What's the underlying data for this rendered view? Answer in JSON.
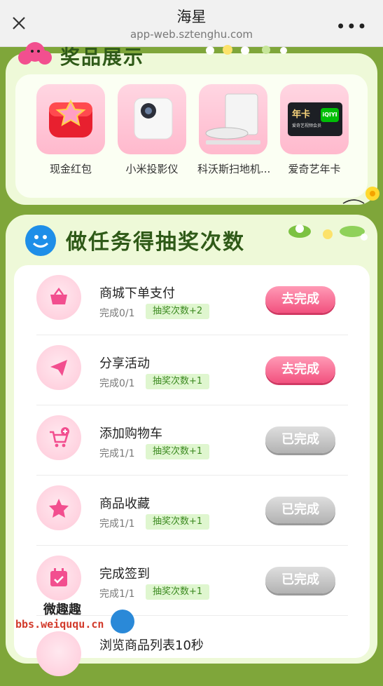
{
  "browser": {
    "title": "海星",
    "url": "app-web.sztenghu.com"
  },
  "prize": {
    "heading": "奖品展示",
    "items": [
      {
        "name": "现金红包"
      },
      {
        "name": "小米投影仪"
      },
      {
        "name": "科沃斯扫地机..."
      },
      {
        "name": "爱奇艺年卡",
        "card_text": "年卡",
        "card_sub": "爱奇艺视频会员",
        "card_logo": "iQIYI"
      }
    ]
  },
  "tasks": {
    "heading": "做任务得抽奖次数",
    "items": [
      {
        "name": "商城下单支付",
        "progress": "完成0/1",
        "reward": "抽奖次数+2",
        "button": "去完成",
        "icon": "basket-icon"
      },
      {
        "name": "分享活动",
        "progress": "完成0/1",
        "reward": "抽奖次数+1",
        "button": "去完成",
        "icon": "paper-plane-icon"
      },
      {
        "name": "添加购物车",
        "progress": "完成1/1",
        "reward": "抽奖次数+1",
        "button": "已完成",
        "icon": "cart-plus-icon"
      },
      {
        "name": "商品收藏",
        "progress": "完成1/1",
        "reward": "抽奖次数+1",
        "button": "已完成",
        "icon": "star-icon"
      },
      {
        "name": "完成签到",
        "progress": "完成1/1",
        "reward": "抽奖次数+1",
        "button": "已完成",
        "icon": "calendar-check-icon"
      },
      {
        "name": "浏览商品列表10秒"
      }
    ]
  },
  "watermark": {
    "top": "微趣趣",
    "bottom": "bbs.weiququ.cn"
  }
}
